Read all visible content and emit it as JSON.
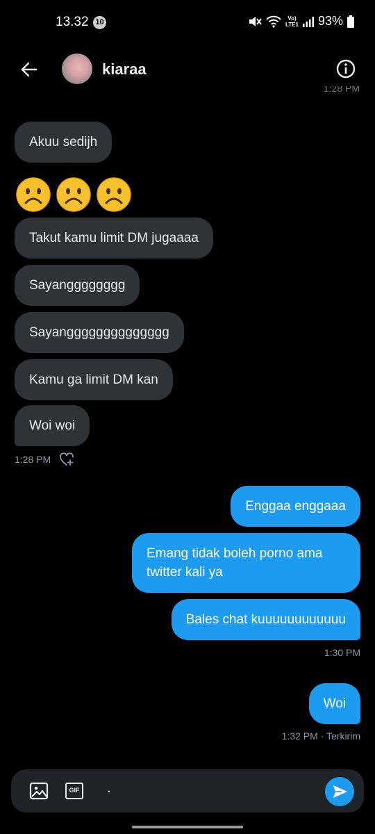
{
  "status_bar": {
    "time": "13.32",
    "notification_count": "10",
    "battery": "93%",
    "network_top": "Vo)",
    "network_bottom": "LTE1"
  },
  "header": {
    "contact_name": "kiaraa",
    "cut_timestamp": "1:28 PM"
  },
  "messages_received": [
    "Akuu sedijh",
    "Takut kamu limit DM jugaaaa",
    "Sayangggggggg",
    "Sayangggggggggggggg",
    "Kamu ga limit DM kan",
    "Woi woi"
  ],
  "emoji_row": [
    "☹️",
    "☹️",
    "☹️"
  ],
  "received_meta": {
    "time": "1:28 PM"
  },
  "messages_sent": [
    "Enggaa enggaaa",
    "Emang tidak boleh porno ama twitter kali ya",
    "Bales chat kuuuuuuuuuuuu",
    "Woi"
  ],
  "sent_meta_1": {
    "time": "1:30 PM"
  },
  "sent_meta_2": {
    "time": "1:32 PM · Terkirim"
  },
  "composer": {
    "input_value": ".",
    "image_icon": "image-icon",
    "gif_label": "GIF",
    "send_icon": "send-icon"
  },
  "colors": {
    "background": "#000000",
    "received_bubble": "#2f3336",
    "sent_bubble": "#1d9bf0",
    "meta_text": "#8b98a5"
  }
}
